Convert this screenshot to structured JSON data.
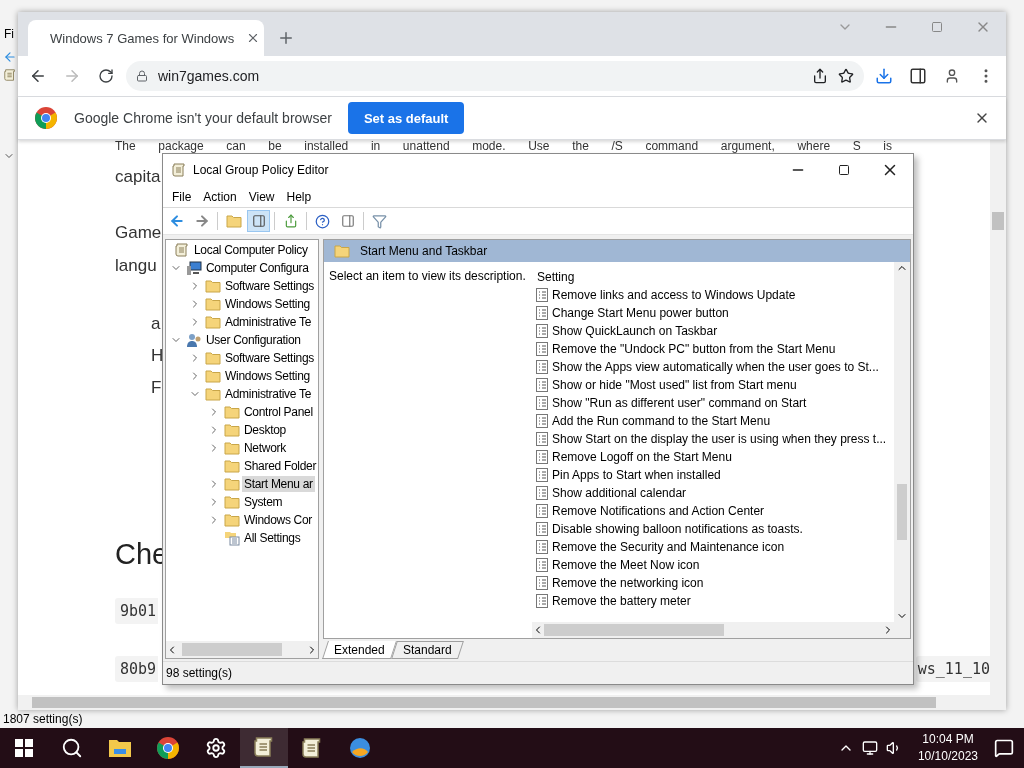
{
  "background_window": {
    "menu": [
      "Fi"
    ],
    "status_bar": "1807 setting(s)"
  },
  "browser": {
    "tab": {
      "title": "Windows 7 Games for Windows",
      "selected": true
    },
    "address": "win7games.com",
    "infobar": {
      "message": "Google Chrome isn't your default browser",
      "button": "Set as default"
    },
    "page": [
      {
        "kind": "text",
        "text": "The package can be installed in unattend mode. Use the /S command argument, where S is"
      },
      {
        "kind": "text",
        "text": "capita"
      },
      {
        "kind": "text",
        "text": "Game"
      },
      {
        "kind": "text",
        "text": "langu"
      },
      {
        "kind": "list",
        "text": "a"
      },
      {
        "kind": "list",
        "text": "H"
      },
      {
        "kind": "list",
        "text": "F"
      },
      {
        "kind": "heading",
        "text": "Che"
      },
      {
        "kind": "code",
        "text": "9b01"
      },
      {
        "kind": "code",
        "text": "80b9",
        "trailing": "ws_11_10"
      }
    ]
  },
  "gpe": {
    "title": "Local Group Policy Editor",
    "menu": [
      "File",
      "Action",
      "View",
      "Help"
    ],
    "tree": {
      "label": "Local Computer Policy",
      "kind": "policy",
      "selected": false,
      "children": [
        {
          "label": "Computer Configura",
          "kind": "computer",
          "expanded": true,
          "selected": false,
          "children": [
            {
              "label": "Software Settings",
              "kind": "folder",
              "expanded": false,
              "selected": false
            },
            {
              "label": "Windows Setting",
              "kind": "folder",
              "expanded": false,
              "selected": false
            },
            {
              "label": "Administrative Te",
              "kind": "folder",
              "expanded": false,
              "selected": false
            }
          ]
        },
        {
          "label": "User Configuration",
          "kind": "user",
          "expanded": true,
          "selected": false,
          "children": [
            {
              "label": "Software Settings",
              "kind": "folder",
              "expanded": false,
              "selected": false
            },
            {
              "label": "Windows Setting",
              "kind": "folder",
              "expanded": false,
              "selected": false
            },
            {
              "label": "Administrative Te",
              "kind": "folder",
              "expanded": true,
              "selected": false,
              "children": [
                {
                  "label": "Control Panel",
                  "kind": "folder",
                  "expanded": false,
                  "selected": false
                },
                {
                  "label": "Desktop",
                  "kind": "folder",
                  "expanded": false,
                  "selected": false
                },
                {
                  "label": "Network",
                  "kind": "folder",
                  "expanded": false,
                  "selected": false
                },
                {
                  "label": "Shared Folder",
                  "kind": "folder",
                  "selected": false
                },
                {
                  "label": "Start Menu ar",
                  "kind": "folder",
                  "expanded": false,
                  "selected": true
                },
                {
                  "label": "System",
                  "kind": "folder",
                  "expanded": false,
                  "selected": false
                },
                {
                  "label": "Windows Cor",
                  "kind": "folder",
                  "expanded": false,
                  "selected": false
                },
                {
                  "label": "All Settings",
                  "kind": "settings",
                  "selected": false
                }
              ]
            }
          ]
        }
      ]
    },
    "panel_title": "Start Menu and Taskbar",
    "description": "Select an item to view its description.",
    "column": "Setting",
    "settings": [
      "Remove links and access to Windows Update",
      "Change Start Menu power button",
      "Show QuickLaunch on Taskbar",
      "Remove the \"Undock PC\" button from the Start Menu",
      "Show the Apps view automatically when the user goes to St...",
      "Show or hide \"Most used\" list from Start menu",
      "Show \"Run as different user\" command on Start",
      "Add the Run command to the Start Menu",
      "Show Start on the display the user is using when they press t...",
      "Remove Logoff on the Start Menu",
      "Pin Apps to Start when installed",
      "Show additional calendar",
      "Remove Notifications and Action Center",
      "Disable showing balloon notifications as toasts.",
      "Remove the Security and Maintenance icon",
      "Remove the Meet Now icon",
      "Remove the networking icon",
      "Remove the battery meter"
    ],
    "tabs": [
      {
        "label": "Extended",
        "selected": true
      },
      {
        "label": "Standard",
        "selected": false
      }
    ],
    "status_bar": "98 setting(s)"
  },
  "taskbar": {
    "apps": [
      {
        "kind": "explorer",
        "active": false
      },
      {
        "kind": "chrome",
        "active": false
      },
      {
        "kind": "settings",
        "active": false
      },
      {
        "kind": "policy",
        "active": true
      },
      {
        "kind": "policy",
        "active": false
      },
      {
        "kind": "ball",
        "active": false
      }
    ],
    "time": "10:04 PM",
    "date": "10/10/2023"
  }
}
